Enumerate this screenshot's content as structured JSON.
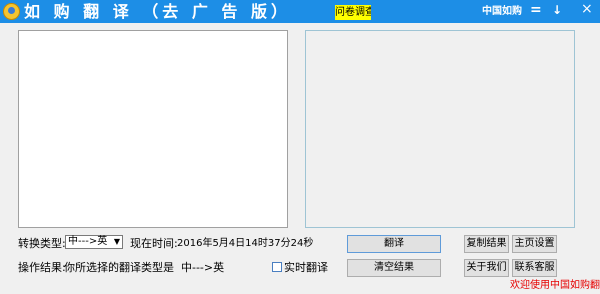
{
  "app": {
    "title": "如 购 翻 译 （去 广 告 版）",
    "survey_label": "问卷调查",
    "brand_label": "中国如购",
    "menu_glyph": "=",
    "minimize_glyph": "↓",
    "close_glyph": "×"
  },
  "conversion": {
    "type_label": "转换类型:",
    "selected": "中--->英",
    "time_label": "现在时间:",
    "time_value": "2016年5月4日14时37分24秒"
  },
  "result": {
    "label": "操作结果:",
    "text": "你所选择的翻译类型是  中--->英"
  },
  "realtime": {
    "label": "实时翻译",
    "checked": false
  },
  "buttons": {
    "translate": "翻译",
    "clear": "清空结果",
    "copy": "复制结果",
    "homepage": "主页设置",
    "about": "关于我们",
    "support": "联系客服"
  },
  "footer": {
    "welcome": "欢迎使用中国如购翻译"
  },
  "colors": {
    "titlebar": "#1d8ee6",
    "survey_highlight": "#ffff00",
    "footer_text": "#e60000"
  }
}
